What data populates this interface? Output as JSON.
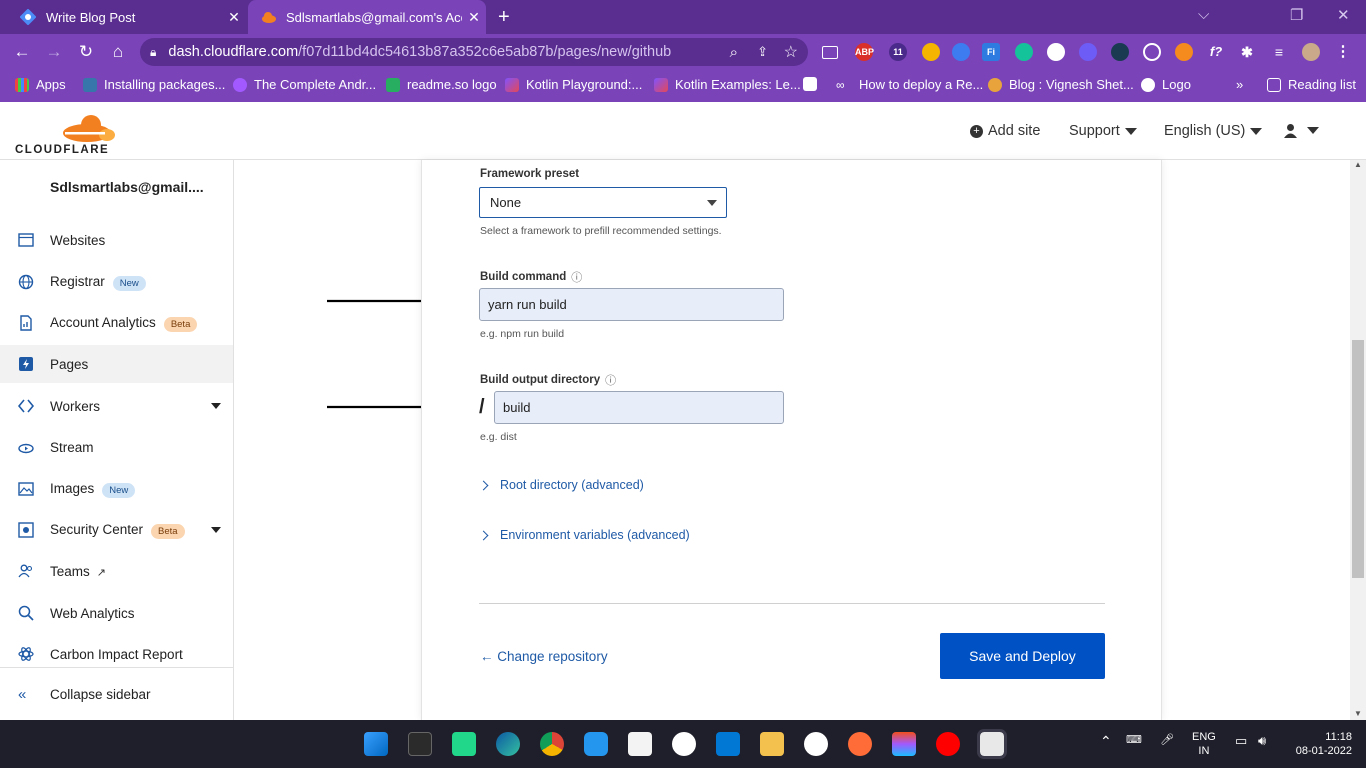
{
  "browser": {
    "tabs": [
      {
        "title": "Write Blog Post",
        "active": false
      },
      {
        "title": "Sdlsmartlabs@gmail.com's Accou",
        "active": true
      }
    ],
    "url_host": "dash.cloudflare.com",
    "url_path": "/f07d11bd4dc54613b87a352c6e5ab87b/pages/new/github",
    "extensions": [
      "ABP",
      "11",
      "Fi",
      "f?"
    ],
    "bookmarks": [
      "Apps",
      "Installing packages...",
      "The Complete Andr...",
      "readme.so logo",
      "Kotlin Playground:...",
      "Kotlin Examples: Le...",
      "How to deploy a Re...",
      "Blog : Vignesh Shet...",
      "Logo"
    ],
    "bookmarks_overflow": "»",
    "reading_list": "Reading list"
  },
  "header": {
    "logo_text": "CLOUDFLARE",
    "add_site": "Add site",
    "support": "Support",
    "language": "English (US)"
  },
  "sidebar": {
    "account": "Sdlsmartlabs@gmail....",
    "items": [
      {
        "label": "Websites",
        "badge": ""
      },
      {
        "label": "Registrar",
        "badge": "New"
      },
      {
        "label": "Account Analytics",
        "badge": "Beta"
      },
      {
        "label": "Pages",
        "badge": ""
      },
      {
        "label": "Workers",
        "badge": ""
      },
      {
        "label": "Stream",
        "badge": ""
      },
      {
        "label": "Images",
        "badge": "New"
      },
      {
        "label": "Security Center",
        "badge": "Beta"
      },
      {
        "label": "Teams",
        "badge": ""
      },
      {
        "label": "Web Analytics",
        "badge": ""
      },
      {
        "label": "Carbon Impact Report",
        "badge": ""
      }
    ],
    "collapse": "Collapse sidebar"
  },
  "form": {
    "framework_label": "Framework preset",
    "framework_value": "None",
    "framework_hint": "Select a framework to prefill recommended settings.",
    "build_command_label": "Build command",
    "build_command_value": "yarn run build",
    "build_command_hint": "e.g. npm run build",
    "output_dir_label": "Build output directory",
    "output_dir_prefix": "/",
    "output_dir_value": "build",
    "output_dir_hint": "e.g. dist",
    "root_dir": "Root directory (advanced)",
    "env_vars": "Environment variables (advanced)",
    "change_repo": "← Change repository",
    "save_deploy": "Save and Deploy"
  },
  "taskbar": {
    "lang_line1": "ENG",
    "lang_line2": "IN",
    "time": "11:18",
    "date": "08-01-2022"
  },
  "colors": {
    "browser_frame": "#5a2d91",
    "browser_toolbar": "#7a44b8",
    "cf_orange": "#f38020",
    "link_blue": "#1f5aa6",
    "button_blue": "#0051c3"
  }
}
